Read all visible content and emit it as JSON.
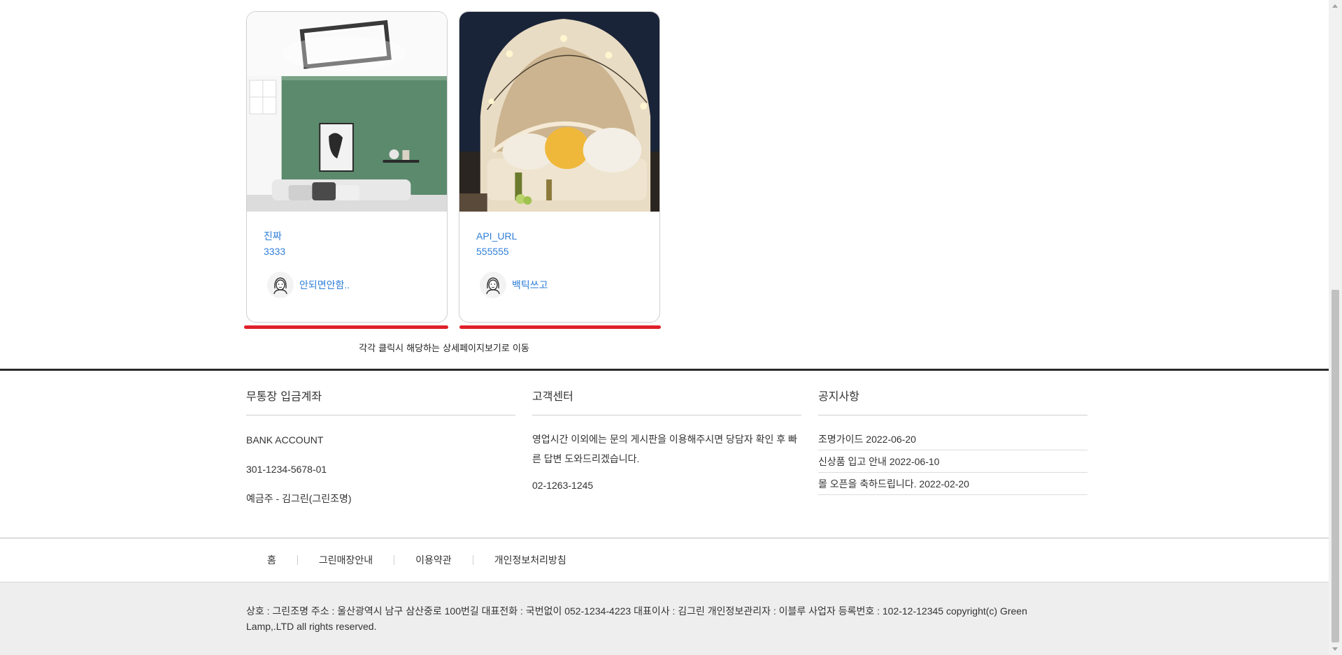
{
  "cards": [
    {
      "title": "진짜",
      "price": "3333",
      "author": "안되면안함..",
      "image": "living-room-ceiling-light-photo"
    },
    {
      "title": "API_URL",
      "price": "555555",
      "author": "백틱쓰고",
      "image": "outdoor-canopy-lounge-photo"
    }
  ],
  "annotation": "각각 클릭시 해당하는 상세페이지보기로 이동",
  "annotation_color": "#e0212b",
  "bank": {
    "heading": "무통장 입금계좌",
    "label": "BANK ACCOUNT",
    "number": "301-1234-5678-01",
    "holder": "예금주 - 김그린(그린조명)"
  },
  "customer_center": {
    "heading": "고객센터",
    "text": "영업시간 이외에는 문의 게시판을 이용해주시면 당담자 확인 후 빠른 답변 도와드리겠습니다.",
    "phone": "02-1263-1245"
  },
  "notices": {
    "heading": "공지사항",
    "items": [
      {
        "title": "조명가이드",
        "date": "2022-06-20"
      },
      {
        "title": "신상품 입고 안내",
        "date": "2022-06-10"
      },
      {
        "title": "몰 오픈을 축하드립니다.",
        "date": "2022-02-20"
      }
    ]
  },
  "bottom_nav": [
    "홈",
    "그린매장안내",
    "이용약관",
    "개인정보처리방침"
  ],
  "company_info": "상호 : 그린조명 주소 : 울산광역시 남구 삼산중로 100번길 대표전화 : 국번없이 052-1234-4223 대표이사 : 김그린 개인정보관리자 : 이블루 사업자 등록번호 : 102-12-12345 copyright(c) Green Lamp,.LTD all rights reserved.",
  "colors": {
    "link": "#2f7fd8",
    "divider": "#2b2b2b",
    "footer_bg": "#eeeeee"
  }
}
